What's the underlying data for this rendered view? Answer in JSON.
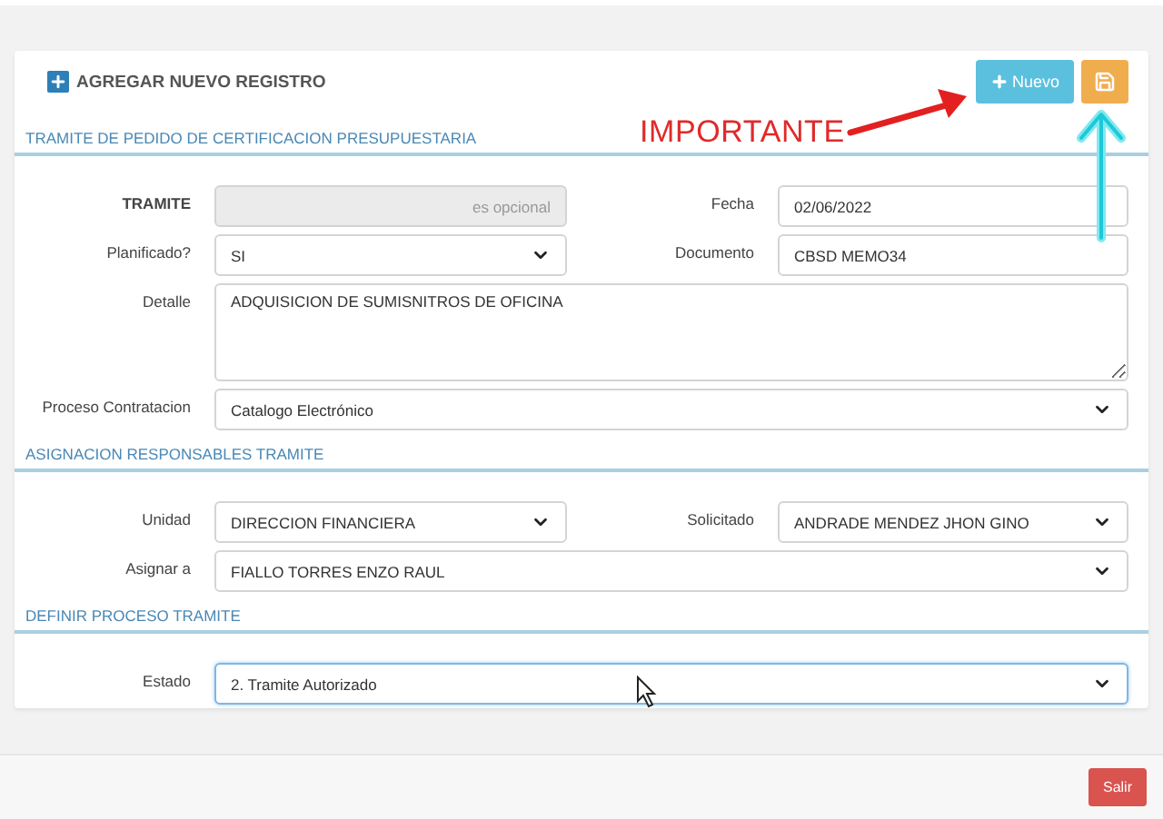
{
  "header": {
    "title": "AGREGAR NUEVO REGISTRO",
    "buttons": [
      {
        "kind": "new",
        "label": "Nuevo"
      },
      {
        "kind": "save"
      }
    ]
  },
  "annotation": {
    "text": "IMPORTANTE"
  },
  "sections": [
    {
      "title": "TRAMITE DE PEDIDO DE CERTIFICACION PRESUPUESTARIA",
      "rows": [
        {
          "fields": [
            {
              "label": "TRAMITE",
              "bold": true,
              "kind": "text",
              "placeholder": "es opcional",
              "disabled": true,
              "focused": false
            },
            {
              "label": "Fecha",
              "bold": false,
              "kind": "date",
              "value": "02/06/2022",
              "disabled": false,
              "focused": false
            }
          ]
        },
        {
          "fields": [
            {
              "label": "Planificado?",
              "bold": false,
              "kind": "select",
              "value": "SI",
              "disabled": false,
              "focused": false
            },
            {
              "label": "Documento",
              "bold": false,
              "kind": "text",
              "value": "CBSD MEMO34",
              "disabled": false,
              "focused": false
            }
          ]
        },
        {
          "fields": [
            {
              "label": "Detalle",
              "bold": false,
              "kind": "textarea",
              "value": "ADQUISICION DE SUMISNITROS DE OFICINA",
              "disabled": false,
              "focused": false
            }
          ]
        },
        {
          "fields": [
            {
              "label": "Proceso Contratacion",
              "bold": false,
              "kind": "select",
              "value": "Catalogo Electrónico",
              "disabled": false,
              "focused": false
            }
          ]
        }
      ]
    },
    {
      "title": "ASIGNACION RESPONSABLES TRAMITE",
      "rows": [
        {
          "fields": [
            {
              "label": "Unidad",
              "bold": false,
              "kind": "select",
              "value": "DIRECCION FINANCIERA",
              "disabled": false,
              "focused": false
            },
            {
              "label": "Solicitado",
              "bold": false,
              "kind": "select",
              "value": "ANDRADE MENDEZ JHON GINO",
              "disabled": false,
              "focused": false
            }
          ]
        },
        {
          "fields": [
            {
              "label": "Asignar a",
              "bold": false,
              "kind": "select",
              "value": "FIALLO TORRES ENZO RAUL",
              "disabled": false,
              "focused": false
            }
          ]
        }
      ]
    },
    {
      "title": "DEFINIR PROCESO TRAMITE",
      "rows": [
        {
          "fields": [
            {
              "label": "Estado",
              "bold": false,
              "kind": "select",
              "value": "2. Tramite Autorizado",
              "disabled": false,
              "focused": true
            }
          ]
        }
      ]
    }
  ],
  "footer": {
    "buttons": [
      {
        "label": "Salir"
      }
    ]
  }
}
